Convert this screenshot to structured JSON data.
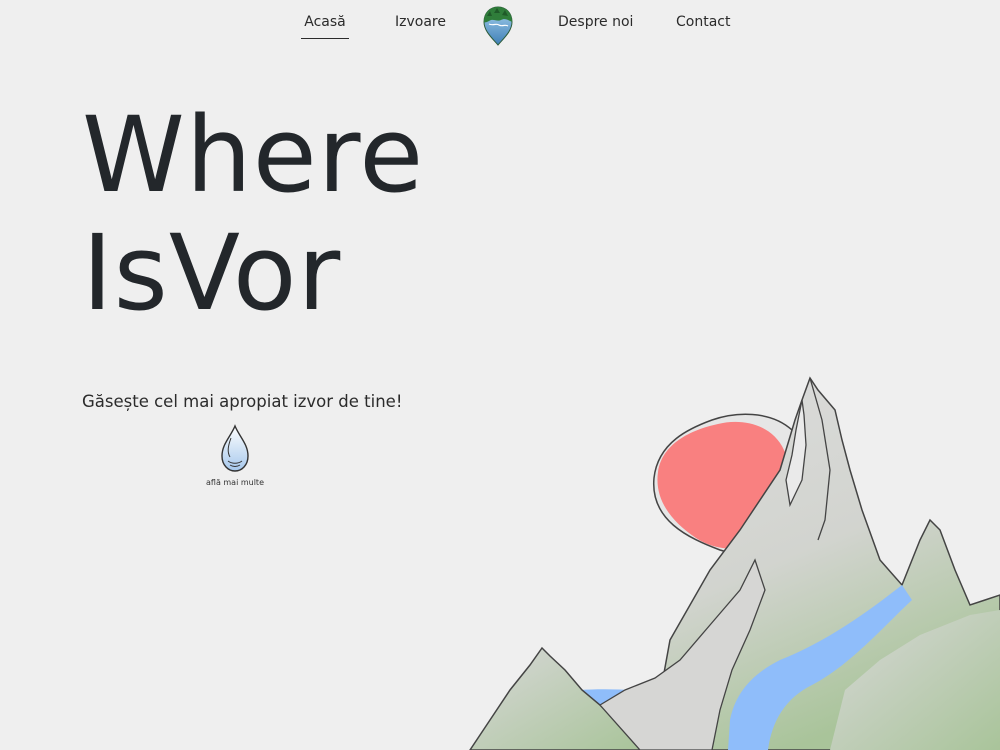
{
  "nav": {
    "items": [
      {
        "label": "Acasă",
        "active": true
      },
      {
        "label": "Izvoare",
        "active": false
      },
      {
        "label": "Despre noi",
        "active": false
      },
      {
        "label": "Contact",
        "active": false
      }
    ],
    "logo_icon": "globe-drop-logo-icon"
  },
  "hero": {
    "title_line1": "Where",
    "title_line2": "IsVor",
    "subtitle": "Găsește cel mai apropiat izvor de tine!",
    "cta_label": "află mai multe",
    "cta_icon": "water-drop-icon"
  },
  "colors": {
    "background": "#efefef",
    "sun": "#f98080",
    "mountain_gray": "#d9d9d9",
    "mountain_green": "#a9c49a",
    "river": "#8fbdfa",
    "text_dark": "#23272b"
  }
}
